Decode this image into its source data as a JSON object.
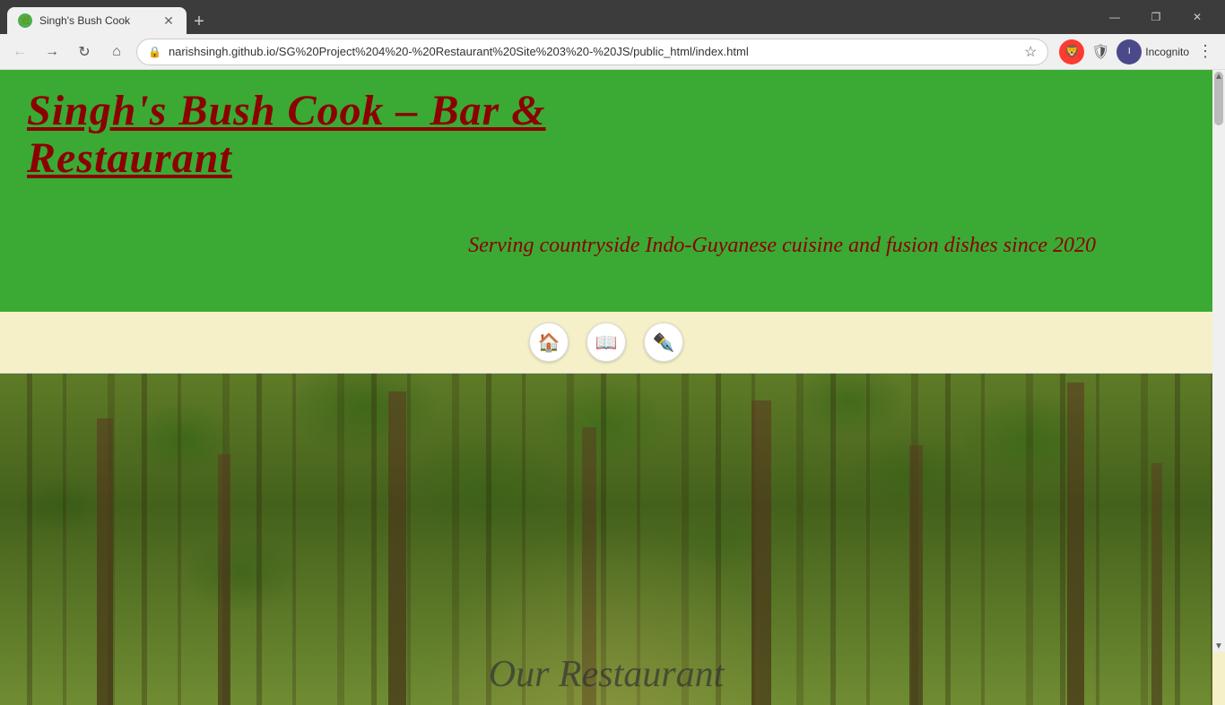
{
  "browser": {
    "tab_title": "Singh's Bush Cook",
    "tab_favicon": "🌿",
    "new_tab_symbol": "+",
    "address_url": "narishsingh.github.io/SG%20Project%204%20-%20Restaurant%20Site%203%20-%20JS/public_html/index.html",
    "win_minimize": "—",
    "win_restore": "❐",
    "win_close": "✕",
    "nav_back": "←",
    "nav_forward": "→",
    "nav_refresh": "↻",
    "nav_home": "⌂",
    "incognito_label": "Incognito",
    "menu_dots": "⋮"
  },
  "site": {
    "title": "Singh's Bush Cook – Bar & Restaurant",
    "subtitle": "Serving countryside Indo-Guyanese cuisine and fusion dishes since 2020",
    "nav": {
      "home_icon": "🏠",
      "menu_icon": "📖",
      "reservation_icon": "✒"
    },
    "hero_text": "Our Restaurant"
  },
  "colors": {
    "header_bg": "#3aaa35",
    "title_color": "#8b0000",
    "page_bg": "#f5f0c8"
  }
}
